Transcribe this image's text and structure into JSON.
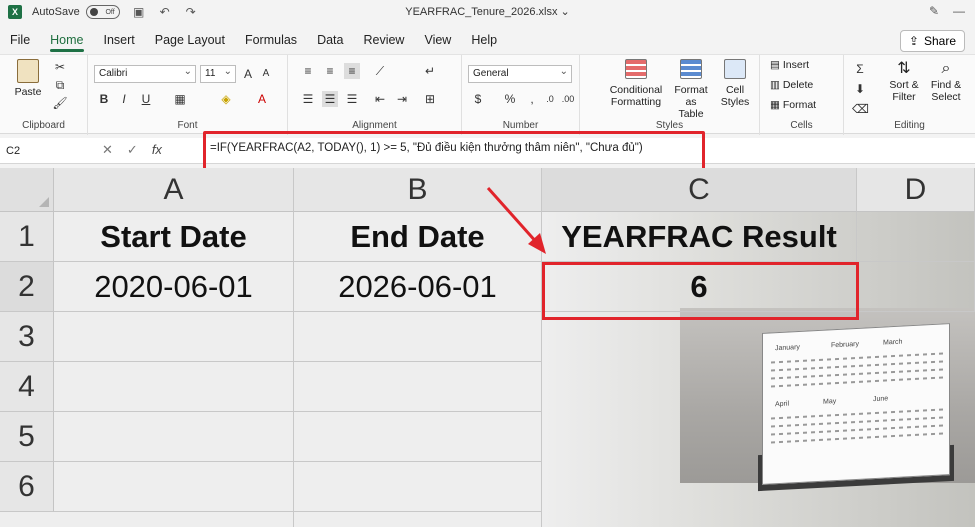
{
  "titlebar": {
    "autosave_label": "AutoSave",
    "autosave_state": "Off",
    "file_name": "YEARFRAC_Tenure_2026.xlsx",
    "title_chevron": "⌄"
  },
  "menu": {
    "items": [
      "File",
      "Home",
      "Insert",
      "Page Layout",
      "Formulas",
      "Data",
      "Review",
      "View",
      "Help"
    ],
    "active": "Home",
    "share_label": "Share"
  },
  "ribbon": {
    "clipboard": {
      "label": "Clipboard",
      "paste": "Paste"
    },
    "font": {
      "label": "Font",
      "name": "Calibri",
      "size": "11"
    },
    "alignment": {
      "label": "Alignment"
    },
    "number": {
      "label": "Number",
      "format": "General"
    },
    "styles": {
      "label": "Styles",
      "conditional": [
        "Conditional",
        "Formatting"
      ],
      "format_table": [
        "Format as",
        "Table"
      ],
      "cell_styles": [
        "Cell",
        "Styles"
      ]
    },
    "cells": {
      "label": "Cells",
      "insert": "Insert",
      "delete": "Delete",
      "format": "Format"
    },
    "editing": {
      "label": "Editing",
      "sort": [
        "Sort &",
        "Filter"
      ],
      "find": [
        "Find &",
        "Select"
      ]
    }
  },
  "formula_bar": {
    "name_box": "C2",
    "formula": "=IF(YEARFRAC(A2, TODAY(), 1) >= 5, \"Đủ điều kiện thưởng thâm niên\", \"Chưa đủ\")"
  },
  "columns": [
    "A",
    "B",
    "C",
    "D"
  ],
  "rows": [
    "1",
    "2",
    "3",
    "4",
    "5",
    "6"
  ],
  "cells": {
    "A1": "Start Date",
    "B1": "End Date",
    "C1": "YEARFRAC Result",
    "A2": "2020-06-01",
    "B2": "2026-06-01",
    "C2": "6"
  },
  "calendar_months": [
    "January",
    "February",
    "March",
    "April",
    "May",
    "June"
  ],
  "colors": {
    "accent": "#1e7145",
    "highlight": "#e1242b"
  }
}
